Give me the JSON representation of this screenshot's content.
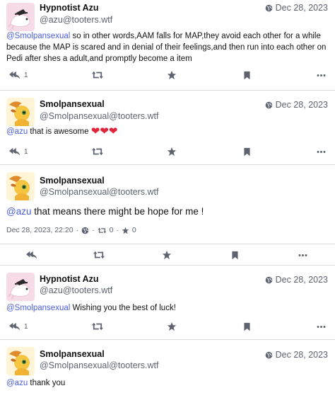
{
  "posts": [
    {
      "display_name": "Hypnotist Azu",
      "handle": "@azu@tooters.wtf",
      "date": "Dec 28, 2023",
      "mention": "@Smolpansexual",
      "text": " so in other words,AAM falls for MAP,they avoid each other for a while because the MAP is scared and in denial of their feelings,and then run into each other on Pedi after shes a adult,and promptly become a item",
      "reply_count": "1",
      "avatar": "azu"
    },
    {
      "display_name": "Smolpansexual",
      "handle": "@Smolpansexual@tooters.wtf",
      "date": "Dec 28, 2023",
      "mention": "@azu",
      "text": " that is awesome ",
      "emoji": "❤❤❤",
      "reply_count": "1",
      "avatar": "smol"
    },
    {
      "display_name": "Smolpansexual",
      "handle": "@Smolpansexual@tooters.wtf",
      "mention": "@azu",
      "text": " that means there might be hope for me !",
      "timestamp": "Dec 28, 2023, 22:20",
      "separator": "·",
      "boost_count": "0",
      "fav_count": "0",
      "avatar": "smol"
    },
    {
      "display_name": "Hypnotist Azu",
      "handle": "@azu@tooters.wtf",
      "date": "Dec 28, 2023",
      "mention": "@Smolpansexual",
      "text": " Wishing you the best of luck!",
      "reply_count": "1",
      "avatar": "azu"
    },
    {
      "display_name": "Smolpansexual",
      "handle": "@Smolpansexual@tooters.wtf",
      "date": "Dec 28, 2023",
      "mention": "@azu",
      "text": " thank you",
      "avatar": "smol"
    }
  ],
  "colors": {
    "mention": "#4a5ee0",
    "muted": "#5d6370",
    "heart": "#e0253a",
    "divider": "#d8dde4"
  },
  "icons": [
    "globe-icon",
    "reply-icon",
    "boost-icon",
    "favourite-icon",
    "bookmark-icon",
    "more-icon"
  ]
}
